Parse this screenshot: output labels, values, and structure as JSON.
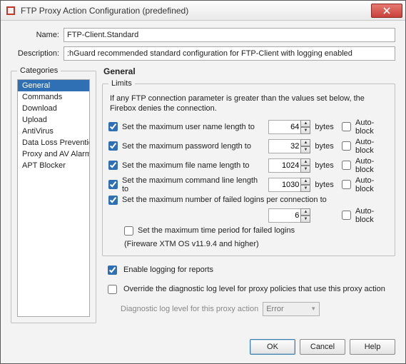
{
  "window": {
    "title": "FTP Proxy Action Configuration (predefined)"
  },
  "form": {
    "name_label": "Name:",
    "name_value": "FTP-Client.Standard",
    "desc_label": "Description:",
    "desc_value": ":hGuard recommended standard configuration for FTP-Client with logging enabled"
  },
  "categories": {
    "legend": "Categories",
    "items": [
      {
        "label": "General",
        "selected": true
      },
      {
        "label": "Commands",
        "selected": false
      },
      {
        "label": "Download",
        "selected": false
      },
      {
        "label": "Upload",
        "selected": false
      },
      {
        "label": "AntiVirus",
        "selected": false
      },
      {
        "label": "Data Loss Prevention",
        "selected": false
      },
      {
        "label": "Proxy and AV Alarms",
        "selected": false
      },
      {
        "label": "APT Blocker",
        "selected": false
      }
    ]
  },
  "general": {
    "heading": "General",
    "limits": {
      "legend": "Limits",
      "desc": "If any FTP connection parameter is greater than the values set below, the Firebox denies the connection.",
      "autoblock_label": "Auto-block",
      "rows": [
        {
          "label": "Set the maximum user name length to",
          "value": "64",
          "unit": "bytes",
          "checked": true,
          "autoblock": false
        },
        {
          "label": "Set the maximum password length to",
          "value": "32",
          "unit": "bytes",
          "checked": true,
          "autoblock": false
        },
        {
          "label": "Set the maximum file name length to",
          "value": "1024",
          "unit": "bytes",
          "checked": true,
          "autoblock": false
        },
        {
          "label": "Set the maximum command line length to",
          "value": "1030",
          "unit": "bytes",
          "checked": true,
          "autoblock": false
        }
      ],
      "failed_logins": {
        "label": "Set the maximum number of failed logins per connection to",
        "checked": true,
        "value": "6",
        "autoblock": false
      },
      "time_period": {
        "label": "Set the maximum time period for failed logins",
        "checked": false
      },
      "firmware_note": "(Fireware XTM OS v11.9.4 and higher)"
    },
    "enable_logging": {
      "label": "Enable logging for reports",
      "checked": true
    },
    "override_diag": {
      "label": "Override the diagnostic log level for proxy policies that use this proxy action",
      "checked": false
    },
    "diag_level": {
      "label": "Diagnostic log level for this proxy action",
      "value": "Error"
    }
  },
  "buttons": {
    "ok": "OK",
    "cancel": "Cancel",
    "help": "Help"
  }
}
